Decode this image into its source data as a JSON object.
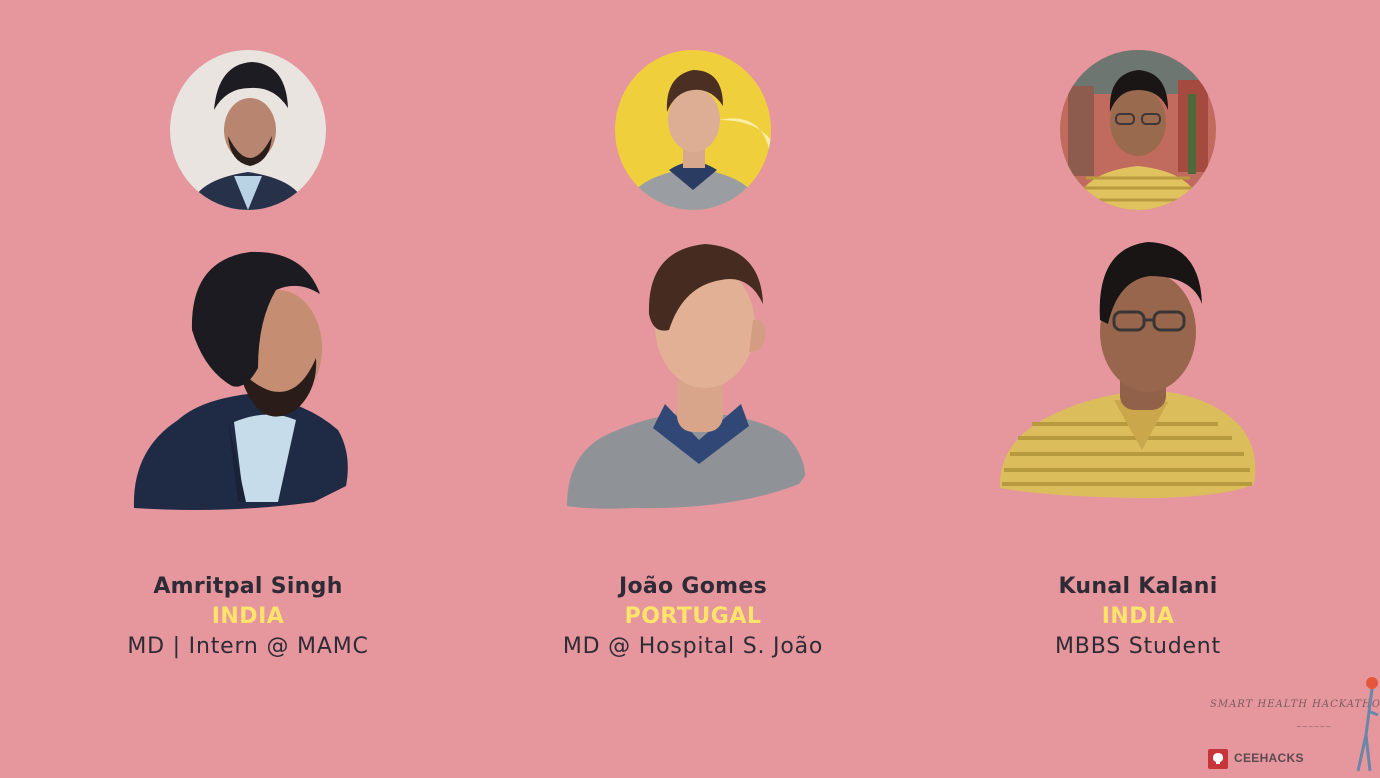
{
  "colors": {
    "background": "#e5979d",
    "text": "#2f2b36",
    "country": "#ffe36a"
  },
  "members": [
    {
      "name": "Amritpal Singh",
      "country": "INDIA",
      "role": "MD | Intern @ MAMC",
      "photo_icon": "amritpal-photo-icon"
    },
    {
      "name": "João Gomes",
      "country": "PORTUGAL",
      "role": "MD @ Hospital S. João",
      "photo_icon": "joao-photo-icon"
    },
    {
      "name": "Kunal Kalani",
      "country": "INDIA",
      "role": "MBBS Student",
      "photo_icon": "kunal-photo-icon"
    }
  ],
  "branding": {
    "event": "SMART HEALTH HACKATHON",
    "organizer": "CEEHACKS"
  }
}
